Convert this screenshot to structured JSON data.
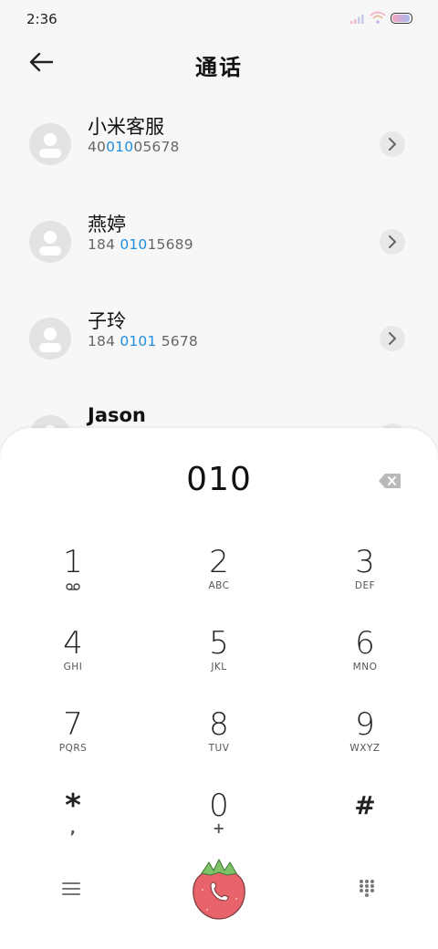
{
  "status_bar": {
    "time": "2:36"
  },
  "header": {
    "title": "通话"
  },
  "contacts": [
    {
      "name": "小米客服",
      "number_parts": [
        "40",
        "010",
        "05678"
      ]
    },
    {
      "name": "燕婷",
      "number_parts": [
        "184 ",
        "010",
        "15689"
      ]
    },
    {
      "name": "子玲",
      "number_parts": [
        "184 ",
        "0101",
        " 5678"
      ]
    },
    {
      "name": "Jason"
    }
  ],
  "dialer": {
    "entry": "010",
    "keys": [
      {
        "digit": "1",
        "sub": ""
      },
      {
        "digit": "2",
        "sub": "ABC"
      },
      {
        "digit": "3",
        "sub": "DEF"
      },
      {
        "digit": "4",
        "sub": "GHI"
      },
      {
        "digit": "5",
        "sub": "JKL"
      },
      {
        "digit": "6",
        "sub": "MNO"
      },
      {
        "digit": "7",
        "sub": "PQRS"
      },
      {
        "digit": "8",
        "sub": "TUV"
      },
      {
        "digit": "9",
        "sub": "WXYZ"
      },
      {
        "digit": "*",
        "sub": ","
      },
      {
        "digit": "0",
        "sub": "+"
      },
      {
        "digit": "#",
        "sub": ""
      }
    ]
  },
  "icons": {
    "back": "arrow-left-icon",
    "backspace": "backspace-icon",
    "menu": "menu-icon",
    "call": "strawberry-call-icon",
    "keypad": "keypad-grid-icon",
    "voicemail": "voicemail-icon"
  },
  "colors": {
    "highlight": "#1f8ee0",
    "call_button": "#e8636b"
  }
}
